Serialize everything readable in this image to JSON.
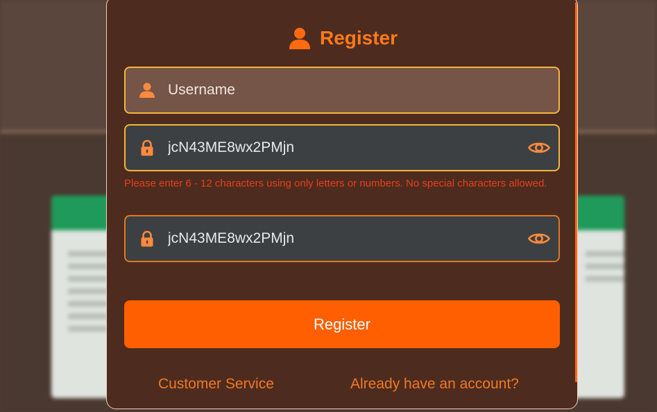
{
  "modal": {
    "title": "Register",
    "username": {
      "placeholder": "Username",
      "value": ""
    },
    "password": {
      "value": "jcN43ME8wx2PMjn"
    },
    "password_error": "Please enter 6 - 12 characters using only letters or numbers. No special characters allowed.",
    "confirm_password": {
      "value": "jcN43ME8wx2PMjn"
    },
    "submit_label": "Register",
    "customer_service_label": "Customer Service",
    "login_link_label": "Already have an account?"
  },
  "icons": {
    "title": "user-icon",
    "username": "user-icon",
    "password": "lock-icon",
    "toggle": "eye-icon"
  },
  "colors": {
    "accent": "#ff5f00",
    "modal_bg": "#4e2b1f",
    "error": "#e2401e",
    "field_focus_border": "#f5b63a"
  }
}
